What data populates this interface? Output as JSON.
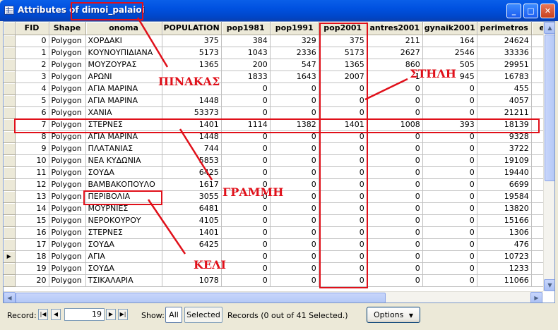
{
  "window": {
    "title": "Attributes of dimoi_palaioi",
    "minimize_label": "_",
    "maximize_label": "□",
    "close_label": "✕"
  },
  "table": {
    "columns": [
      "",
      "FID",
      "Shape",
      "onoma",
      "POPULATION",
      "pop1981",
      "pop1991",
      "pop2001",
      "antres2001",
      "gynaik2001",
      "perimetros",
      "e"
    ],
    "rows": [
      [
        "0",
        "Polygon",
        "ΧΟΡΔΑΚΙ",
        "375",
        "384",
        "329",
        "375",
        "211",
        "164",
        "24624"
      ],
      [
        "1",
        "Polygon",
        "ΚΟΥΝΟΥΠΙΔΙΑΝΑ",
        "5173",
        "1043",
        "2336",
        "5173",
        "2627",
        "2546",
        "33336"
      ],
      [
        "2",
        "Polygon",
        "ΜΟΥΖΟΥΡΑΣ",
        "1365",
        "200",
        "547",
        "1365",
        "860",
        "505",
        "29951"
      ],
      [
        "3",
        "Polygon",
        "ΑΡΩΝΙ",
        "",
        "1833",
        "1643",
        "2007",
        "1",
        "945",
        "16783"
      ],
      [
        "4",
        "Polygon",
        "ΑΓΙΑ ΜΑΡΙΝΑ",
        "",
        "0",
        "0",
        "0",
        "0",
        "0",
        "455"
      ],
      [
        "5",
        "Polygon",
        "ΑΓΙΑ ΜΑΡΙΝΑ",
        "1448",
        "0",
        "0",
        "0",
        "0",
        "0",
        "4057"
      ],
      [
        "6",
        "Polygon",
        "ΧΑΝΙΑ",
        "53373",
        "0",
        "0",
        "0",
        "0",
        "0",
        "21211"
      ],
      [
        "7",
        "Polygon",
        "ΣΤΕΡΝΕΣ",
        "1401",
        "1114",
        "1382",
        "1401",
        "1008",
        "393",
        "18139"
      ],
      [
        "8",
        "Polygon",
        "ΑΓΙΑ ΜΑΡΙΝΑ",
        "1448",
        "0",
        "0",
        "0",
        "0",
        "0",
        "9328"
      ],
      [
        "9",
        "Polygon",
        "ΠΛΑΤΑΝΙΑΣ",
        "744",
        "0",
        "0",
        "0",
        "0",
        "0",
        "3722"
      ],
      [
        "10",
        "Polygon",
        "ΝΕΑ ΚΥΔΩΝΙΑ",
        "5853",
        "0",
        "0",
        "0",
        "0",
        "0",
        "19109"
      ],
      [
        "11",
        "Polygon",
        "ΣΟΥΔΑ",
        "6425",
        "0",
        "0",
        "0",
        "0",
        "0",
        "19440"
      ],
      [
        "12",
        "Polygon",
        "ΒΑΜΒΑΚΟΠΟΥΛΟ",
        "1617",
        "0",
        "0",
        "0",
        "0",
        "0",
        "6699"
      ],
      [
        "13",
        "Polygon",
        "ΠΕΡΙΒΟΛΙΑ",
        "3055",
        "0",
        "0",
        "0",
        "0",
        "0",
        "19584"
      ],
      [
        "14",
        "Polygon",
        "ΜΟΥΡΝΙΕΣ",
        "6481",
        "0",
        "0",
        "0",
        "0",
        "0",
        "13820"
      ],
      [
        "15",
        "Polygon",
        "ΝΕΡΟΚΟΥΡΟΥ",
        "4105",
        "0",
        "0",
        "0",
        "0",
        "0",
        "15166"
      ],
      [
        "16",
        "Polygon",
        "ΣΤΕΡΝΕΣ",
        "1401",
        "0",
        "0",
        "0",
        "0",
        "0",
        "1306"
      ],
      [
        "17",
        "Polygon",
        "ΣΟΥΔΑ",
        "6425",
        "0",
        "0",
        "0",
        "0",
        "0",
        "476"
      ],
      [
        "18",
        "Polygon",
        "ΑΓΙΑ",
        "",
        "0",
        "0",
        "0",
        "0",
        "0",
        "10723"
      ],
      [
        "19",
        "Polygon",
        "ΣΟΥΔΑ",
        "",
        "0",
        "0",
        "0",
        "0",
        "0",
        "1233"
      ],
      [
        "20",
        "Polygon",
        "ΤΣΙΚΑΛΑΡΙΑ",
        "1078",
        "0",
        "0",
        "0",
        "0",
        "0",
        "11066"
      ]
    ],
    "current_row": 18
  },
  "status": {
    "record_label": "Record:",
    "record_value": "19",
    "show_label": "Show:",
    "all_label": "All",
    "selected_label": "Selected",
    "records_text": "Records  (0 out of 41 Selected.)",
    "options_label": "Options"
  },
  "annotations": {
    "table_label": "ΠΙΝΑΚΑΣ",
    "column_label": "ΣΤΗΛΗ",
    "row_label": "ΓΡΑΜΜΗ",
    "cell_label": "ΚΕΛΙ"
  },
  "colors": {
    "annotation": "#e0101a",
    "titlebar": "#0051e0"
  }
}
